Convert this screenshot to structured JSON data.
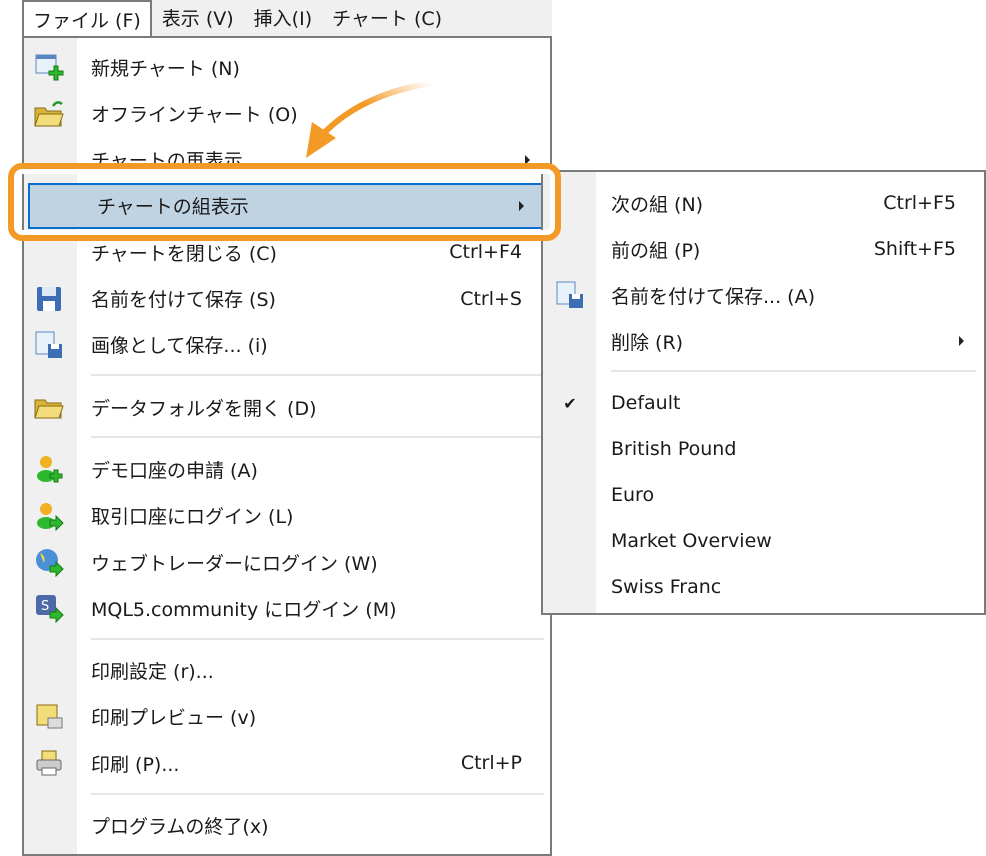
{
  "menubar": [
    {
      "label": "ファイル (F)",
      "active": true
    },
    {
      "label": "表示 (V)"
    },
    {
      "label": "挿入(I)"
    },
    {
      "label": "チャート (C)"
    }
  ],
  "file_menu": {
    "items": [
      {
        "label": "新規チャート (N)",
        "icon": "new-chart-icon"
      },
      {
        "label": "オフラインチャート (O)",
        "icon": "folder-refresh-icon"
      },
      {
        "label": "チャートの再表示",
        "submenu": true
      },
      {
        "label": "チャートの組表示",
        "submenu": true,
        "highlighted": true
      },
      {
        "label": "チャートを閉じる (C)",
        "shortcut": "Ctrl+F4"
      },
      {
        "label": "名前を付けて保存 (S)",
        "shortcut": "Ctrl+S",
        "icon": "floppy-icon"
      },
      {
        "label": "画像として保存... (i)",
        "icon": "save-image-icon"
      },
      {
        "separator": true
      },
      {
        "label": "データフォルダを開く (D)",
        "icon": "folder-icon"
      },
      {
        "separator": true
      },
      {
        "label": "デモ口座の申請 (A)",
        "icon": "user-add-icon"
      },
      {
        "label": "取引口座にログイン (L)",
        "icon": "user-login-icon"
      },
      {
        "label": "ウェブトレーダーにログイン (W)",
        "icon": "globe-login-icon"
      },
      {
        "label": "MQL5.community にログイン (M)",
        "icon": "mql5-login-icon"
      },
      {
        "separator": true
      },
      {
        "label": "印刷設定 (r)..."
      },
      {
        "label": "印刷プレビュー (v)",
        "icon": "print-preview-icon"
      },
      {
        "label": "印刷 (P)...",
        "shortcut": "Ctrl+P",
        "icon": "printer-icon"
      },
      {
        "separator": true
      },
      {
        "label": "プログラムの終了(x)"
      }
    ]
  },
  "sub_menu": {
    "items": [
      {
        "label": "次の組 (N)",
        "shortcut": "Ctrl+F5"
      },
      {
        "label": "前の組 (P)",
        "shortcut": "Shift+F5"
      },
      {
        "label": "名前を付けて保存... (A)",
        "icon": "save-template-icon"
      },
      {
        "label": "削除 (R)",
        "submenu": true
      },
      {
        "separator": true
      },
      {
        "label": "Default",
        "checked": true
      },
      {
        "label": "British Pound"
      },
      {
        "label": "Euro"
      },
      {
        "label": "Market Overview"
      },
      {
        "label": "Swiss Franc"
      }
    ]
  },
  "colors": {
    "highlight": "#bfd3e3",
    "highlight_border": "#0a6fcc",
    "annotation": "#f39a26"
  }
}
